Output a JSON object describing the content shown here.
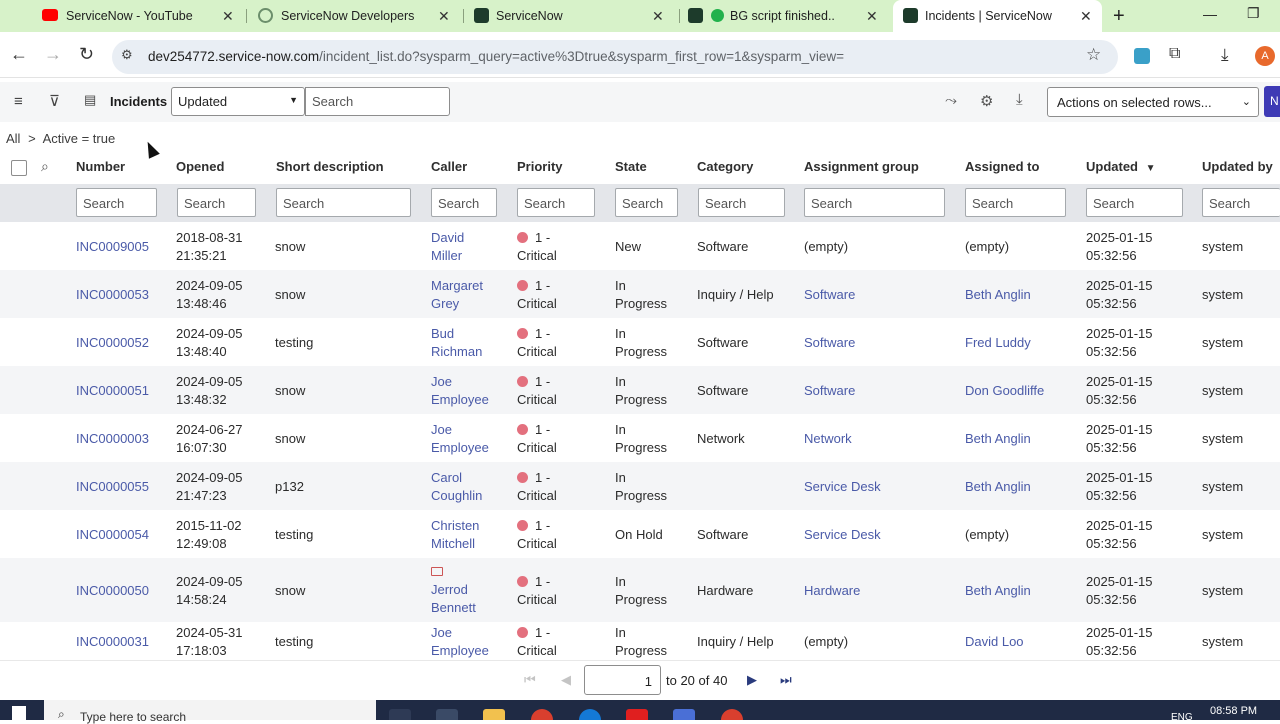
{
  "browser": {
    "tabs": [
      {
        "title": "ServiceNow - YouTube",
        "icon": "youtube-icon"
      },
      {
        "title": "ServiceNow Developers",
        "icon": "servicenow-dev-icon"
      },
      {
        "title": "ServiceNow",
        "icon": "servicenow-icon"
      },
      {
        "title": "BG script finished..",
        "icon": "servicenow-icon"
      },
      {
        "title": "Incidents | ServiceNow",
        "icon": "servicenow-icon"
      }
    ],
    "url_host": "dev254772.service-now.com",
    "url_path": "/incident_list.do?sysparm_query=active%3Dtrue&sysparm_first_row=1&sysparm_view=",
    "profile_initial": "A"
  },
  "list": {
    "title": "Incidents",
    "sort_field": "Updated",
    "search_placeholder": "Search",
    "actions_label": "Actions on selected rows...",
    "new_label": "N",
    "breadcrumb_all": "All",
    "breadcrumb_sep": ">",
    "breadcrumb_filter": "Active = true"
  },
  "columns": [
    {
      "label": "Number"
    },
    {
      "label": "Opened"
    },
    {
      "label": "Short description"
    },
    {
      "label": "Caller"
    },
    {
      "label": "Priority"
    },
    {
      "label": "State"
    },
    {
      "label": "Category"
    },
    {
      "label": "Assignment group"
    },
    {
      "label": "Assigned to"
    },
    {
      "label": "Updated"
    },
    {
      "label": "Updated by"
    }
  ],
  "rows": [
    {
      "number": "INC0009005",
      "opened_date": "2018-08-31",
      "opened_time": "21:35:21",
      "short": "snow",
      "caller1": "David",
      "caller2": "Miller",
      "pri1": "1 -",
      "pri2": "Critical",
      "state1": "New",
      "state2": "",
      "category": "Software",
      "group": "(empty)",
      "group_link": false,
      "assigned": "(empty)",
      "assigned_link": false,
      "upd_date": "2025-01-15",
      "upd_time": "05:32:56",
      "updby": "system"
    },
    {
      "number": "INC0000053",
      "opened_date": "2024-09-05",
      "opened_time": "13:48:46",
      "short": "snow",
      "caller1": "Margaret",
      "caller2": "Grey",
      "pri1": "1 -",
      "pri2": "Critical",
      "state1": "In",
      "state2": "Progress",
      "category": "Inquiry / Help",
      "group": "Software",
      "group_link": true,
      "assigned": "Beth Anglin",
      "assigned_link": true,
      "upd_date": "2025-01-15",
      "upd_time": "05:32:56",
      "updby": "system"
    },
    {
      "number": "INC0000052",
      "opened_date": "2024-09-05",
      "opened_time": "13:48:40",
      "short": "testing",
      "caller1": "Bud",
      "caller2": "Richman",
      "pri1": "1 -",
      "pri2": "Critical",
      "state1": "In",
      "state2": "Progress",
      "category": "Software",
      "group": "Software",
      "group_link": true,
      "assigned": "Fred Luddy",
      "assigned_link": true,
      "upd_date": "2025-01-15",
      "upd_time": "05:32:56",
      "updby": "system"
    },
    {
      "number": "INC0000051",
      "opened_date": "2024-09-05",
      "opened_time": "13:48:32",
      "short": "snow",
      "caller1": "Joe",
      "caller2": "Employee",
      "pri1": "1 -",
      "pri2": "Critical",
      "state1": "In",
      "state2": "Progress",
      "category": "Software",
      "group": "Software",
      "group_link": true,
      "assigned": "Don Goodliffe",
      "assigned_link": true,
      "upd_date": "2025-01-15",
      "upd_time": "05:32:56",
      "updby": "system"
    },
    {
      "number": "INC0000003",
      "opened_date": "2024-06-27",
      "opened_time": "16:07:30",
      "short": "snow",
      "caller1": "Joe",
      "caller2": "Employee",
      "pri1": "1 -",
      "pri2": "Critical",
      "state1": "In",
      "state2": "Progress",
      "category": "Network",
      "group": "Network",
      "group_link": true,
      "assigned": "Beth Anglin",
      "assigned_link": true,
      "upd_date": "2025-01-15",
      "upd_time": "05:32:56",
      "updby": "system"
    },
    {
      "number": "INC0000055",
      "opened_date": "2024-09-05",
      "opened_time": "21:47:23",
      "short": "p132",
      "caller1": "Carol",
      "caller2": "Coughlin",
      "pri1": "1 -",
      "pri2": "Critical",
      "state1": "In",
      "state2": "Progress",
      "category": "",
      "group": "Service Desk",
      "group_link": true,
      "assigned": "Beth Anglin",
      "assigned_link": true,
      "upd_date": "2025-01-15",
      "upd_time": "05:32:56",
      "updby": "system"
    },
    {
      "number": "INC0000054",
      "opened_date": "2015-11-02",
      "opened_time": "12:49:08",
      "short": "testing",
      "caller1": "Christen",
      "caller2": "Mitchell",
      "pri1": "1 -",
      "pri2": "Critical",
      "state1": "On Hold",
      "state2": "",
      "category": "Software",
      "group": "Service Desk",
      "group_link": true,
      "assigned": "(empty)",
      "assigned_link": false,
      "upd_date": "2025-01-15",
      "upd_time": "05:32:56",
      "updby": "system"
    },
    {
      "number": "INC0000050",
      "opened_date": "2024-09-05",
      "opened_time": "14:58:24",
      "short": "snow",
      "caller1": "Jerrod",
      "caller2": "Bennett",
      "pri1": "1 -",
      "pri2": "Critical",
      "state1": "In",
      "state2": "Progress",
      "category": "Hardware",
      "group": "Hardware",
      "group_link": true,
      "assigned": "Beth Anglin",
      "assigned_link": true,
      "upd_date": "2025-01-15",
      "upd_time": "05:32:56",
      "updby": "system"
    },
    {
      "number": "INC0000031",
      "opened_date": "2024-05-31",
      "opened_time": "17:18:03",
      "short": "testing",
      "caller1": "Joe",
      "caller2": "Employee",
      "pri1": "1 -",
      "pri2": "Critical",
      "state1": "In",
      "state2": "Progress",
      "category": "Inquiry / Help",
      "group": "(empty)",
      "group_link": false,
      "assigned": "David Loo",
      "assigned_link": true,
      "upd_date": "2025-01-15",
      "upd_time": "05:32:56",
      "updby": "system"
    }
  ],
  "pager": {
    "page_value": "1",
    "range_text": "to 20 of 40"
  },
  "taskbar": {
    "search_placeholder": "Type here to search",
    "clock": "08:58 PM",
    "lang": "ENG"
  }
}
